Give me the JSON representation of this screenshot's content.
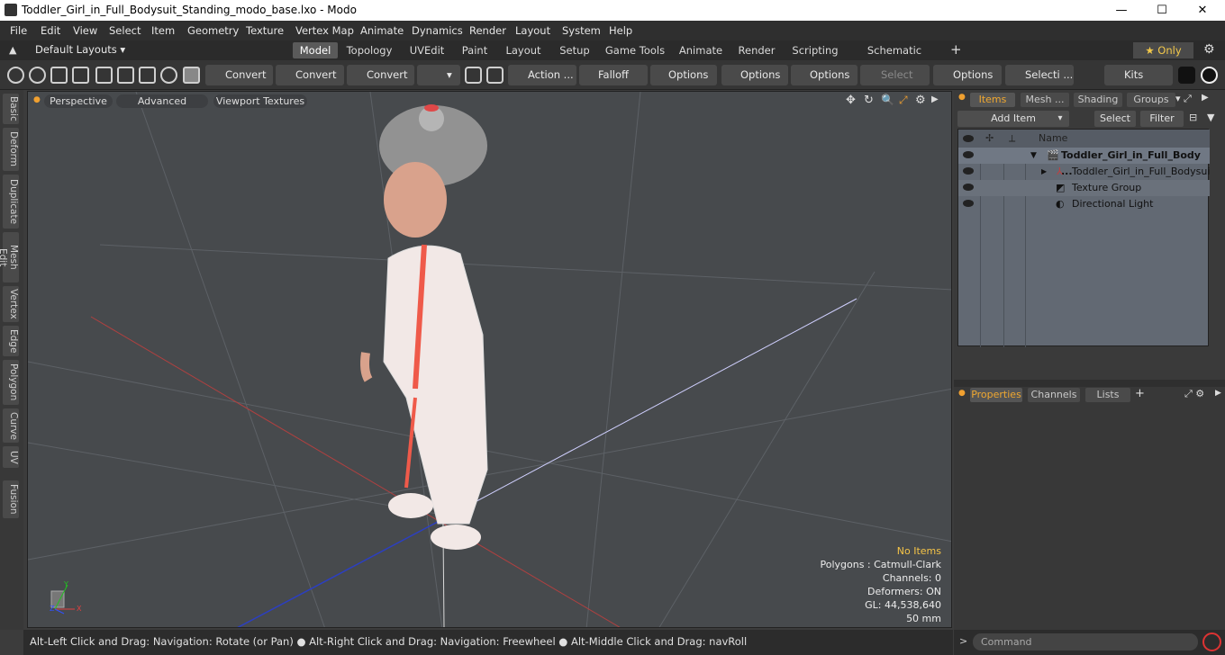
{
  "window": {
    "title": "Toddler_Girl_in_Full_Bodysuit_Standing_modo_base.lxo - Modo",
    "minimize": "—",
    "maximize": "☐",
    "close": "✕"
  },
  "menu": [
    "File",
    "Edit",
    "View",
    "Select",
    "Item",
    "Geometry",
    "Texture",
    "Vertex Map",
    "Animate",
    "Dynamics",
    "Render",
    "Layout",
    "System",
    "Help"
  ],
  "layouts": {
    "selector": "Default Layouts ▾",
    "tabs": [
      "Model",
      "Topology",
      "UVEdit",
      "Paint",
      "Layout",
      "Setup",
      "Game Tools",
      "Animate",
      "Render",
      "Scripting",
      "Schematic Fusion"
    ],
    "active": "Model",
    "add": "+",
    "only": "★  Only",
    "gear": "⚙"
  },
  "toolbar": {
    "convert1": "Convert",
    "convert2": "Convert",
    "convert3": "Convert",
    "action": "Action  ...",
    "falloff": "Falloff",
    "options1": "Options",
    "options2": "Options",
    "options3": "Options",
    "select_t": "Select T...",
    "options4": "Options",
    "selecti": "Selecti ...",
    "kits": "Kits"
  },
  "left_tabs": [
    "Basic",
    "Deform",
    "Duplicate",
    "Mesh Edit",
    "Vertex",
    "Edge",
    "Polygon",
    "Curve",
    "UV",
    "Fusion"
  ],
  "viewport": {
    "perspective": "Perspective",
    "advanced": "Advanced",
    "viewport_textures": "Viewport Textures",
    "hud": {
      "no_items": "No Items",
      "polygons": "Polygons : Catmull-Clark",
      "channels": "Channels: 0",
      "deformers": "Deformers: ON",
      "gl": "GL: 44,538,640",
      "focal": "50 mm"
    },
    "axis": {
      "y": "Y",
      "x": "X",
      "z": "Z"
    }
  },
  "status": "Alt-Left Click and Drag: Navigation: Rotate (or Pan) ● Alt-Right Click and Drag: Navigation: Freewheel ● Alt-Middle Click and Drag: navRoll",
  "items_panel": {
    "tabs": [
      "Items",
      "Mesh ...",
      "Shading",
      "Groups"
    ],
    "active": "Items",
    "add_item": "Add Item",
    "add_item_arrow": "▾",
    "select": "Select",
    "filter": "Filter",
    "name_header": "Name",
    "rows": [
      {
        "label": "Toddler_Girl_in_Full_Body ...",
        "icon": "🎬"
      },
      {
        "label": "Toddler_Girl_in_Full_Bodysui ..."
      },
      {
        "label": "Texture Group"
      },
      {
        "label": "Directional Light"
      }
    ]
  },
  "props_panel": {
    "tabs": [
      "Properties",
      "Channels",
      "Lists"
    ],
    "active": "Properties",
    "add": "+"
  },
  "command": {
    "placeholder": "Command",
    "prompt": ">"
  }
}
